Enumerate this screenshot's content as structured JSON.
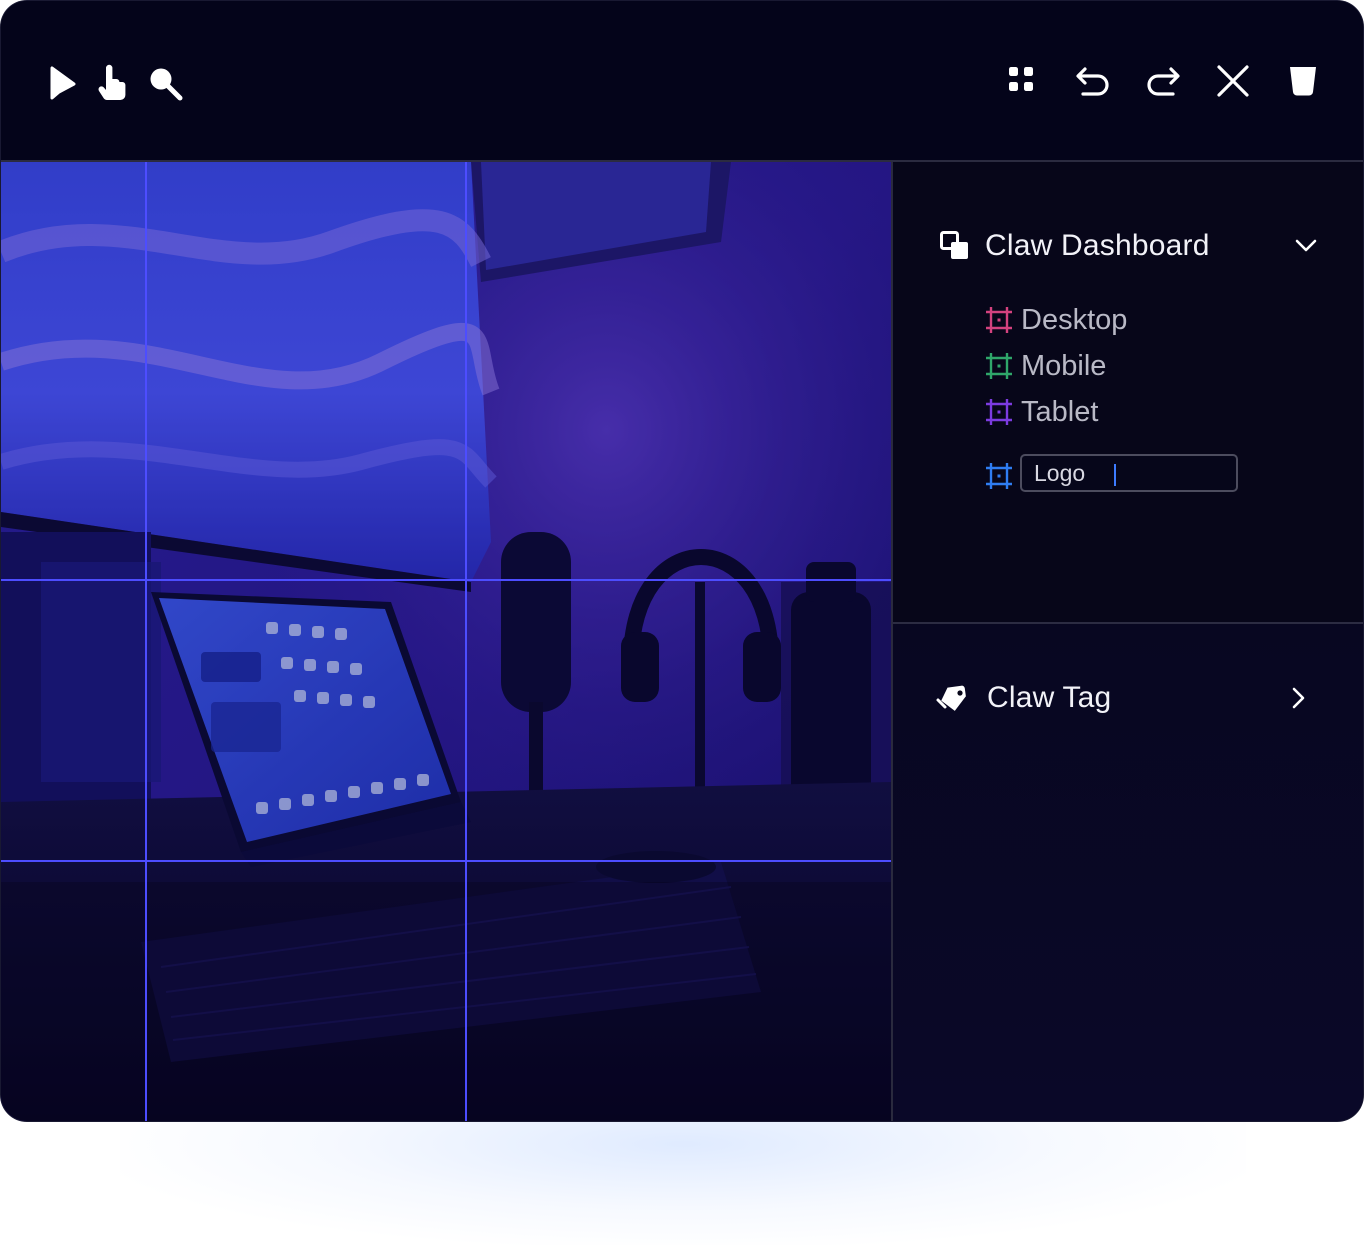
{
  "toolbar": {
    "left_tools": [
      {
        "icon": "pointer-arrow-icon",
        "label": "Select"
      },
      {
        "icon": "hand-pointer-icon",
        "label": "Hand"
      },
      {
        "icon": "search-icon",
        "label": "Zoom"
      }
    ],
    "right_tools": [
      {
        "icon": "grid-icon"
      },
      {
        "icon": "undo-icon"
      },
      {
        "icon": "redo-icon"
      },
      {
        "icon": "close-icon"
      },
      {
        "icon": "trash-icon"
      }
    ]
  },
  "layers_panel": {
    "title": "Claw Dashboard",
    "title_icon": "layers-icon",
    "expanded": true,
    "items": [
      {
        "label": "Desktop",
        "icon": "frame-icon",
        "color": "#d4427f"
      },
      {
        "label": "Mobile",
        "icon": "frame-icon",
        "color": "#2fa66a"
      },
      {
        "label": "Tablet",
        "icon": "frame-icon",
        "color": "#7c3be0"
      }
    ],
    "rename": {
      "value": "Logo",
      "icon": "frame-icon",
      "color": "#2f7df2"
    }
  },
  "tag_panel": {
    "title": "Claw Tag",
    "icon": "tags-icon",
    "expanded": false
  },
  "colors": {
    "toolbar_bg": "#04041a",
    "panel_bg": "#070619",
    "grid_guides": "#4d4dff",
    "text_primary": "#f2f2f8",
    "text_secondary": "#b9b9c6"
  }
}
